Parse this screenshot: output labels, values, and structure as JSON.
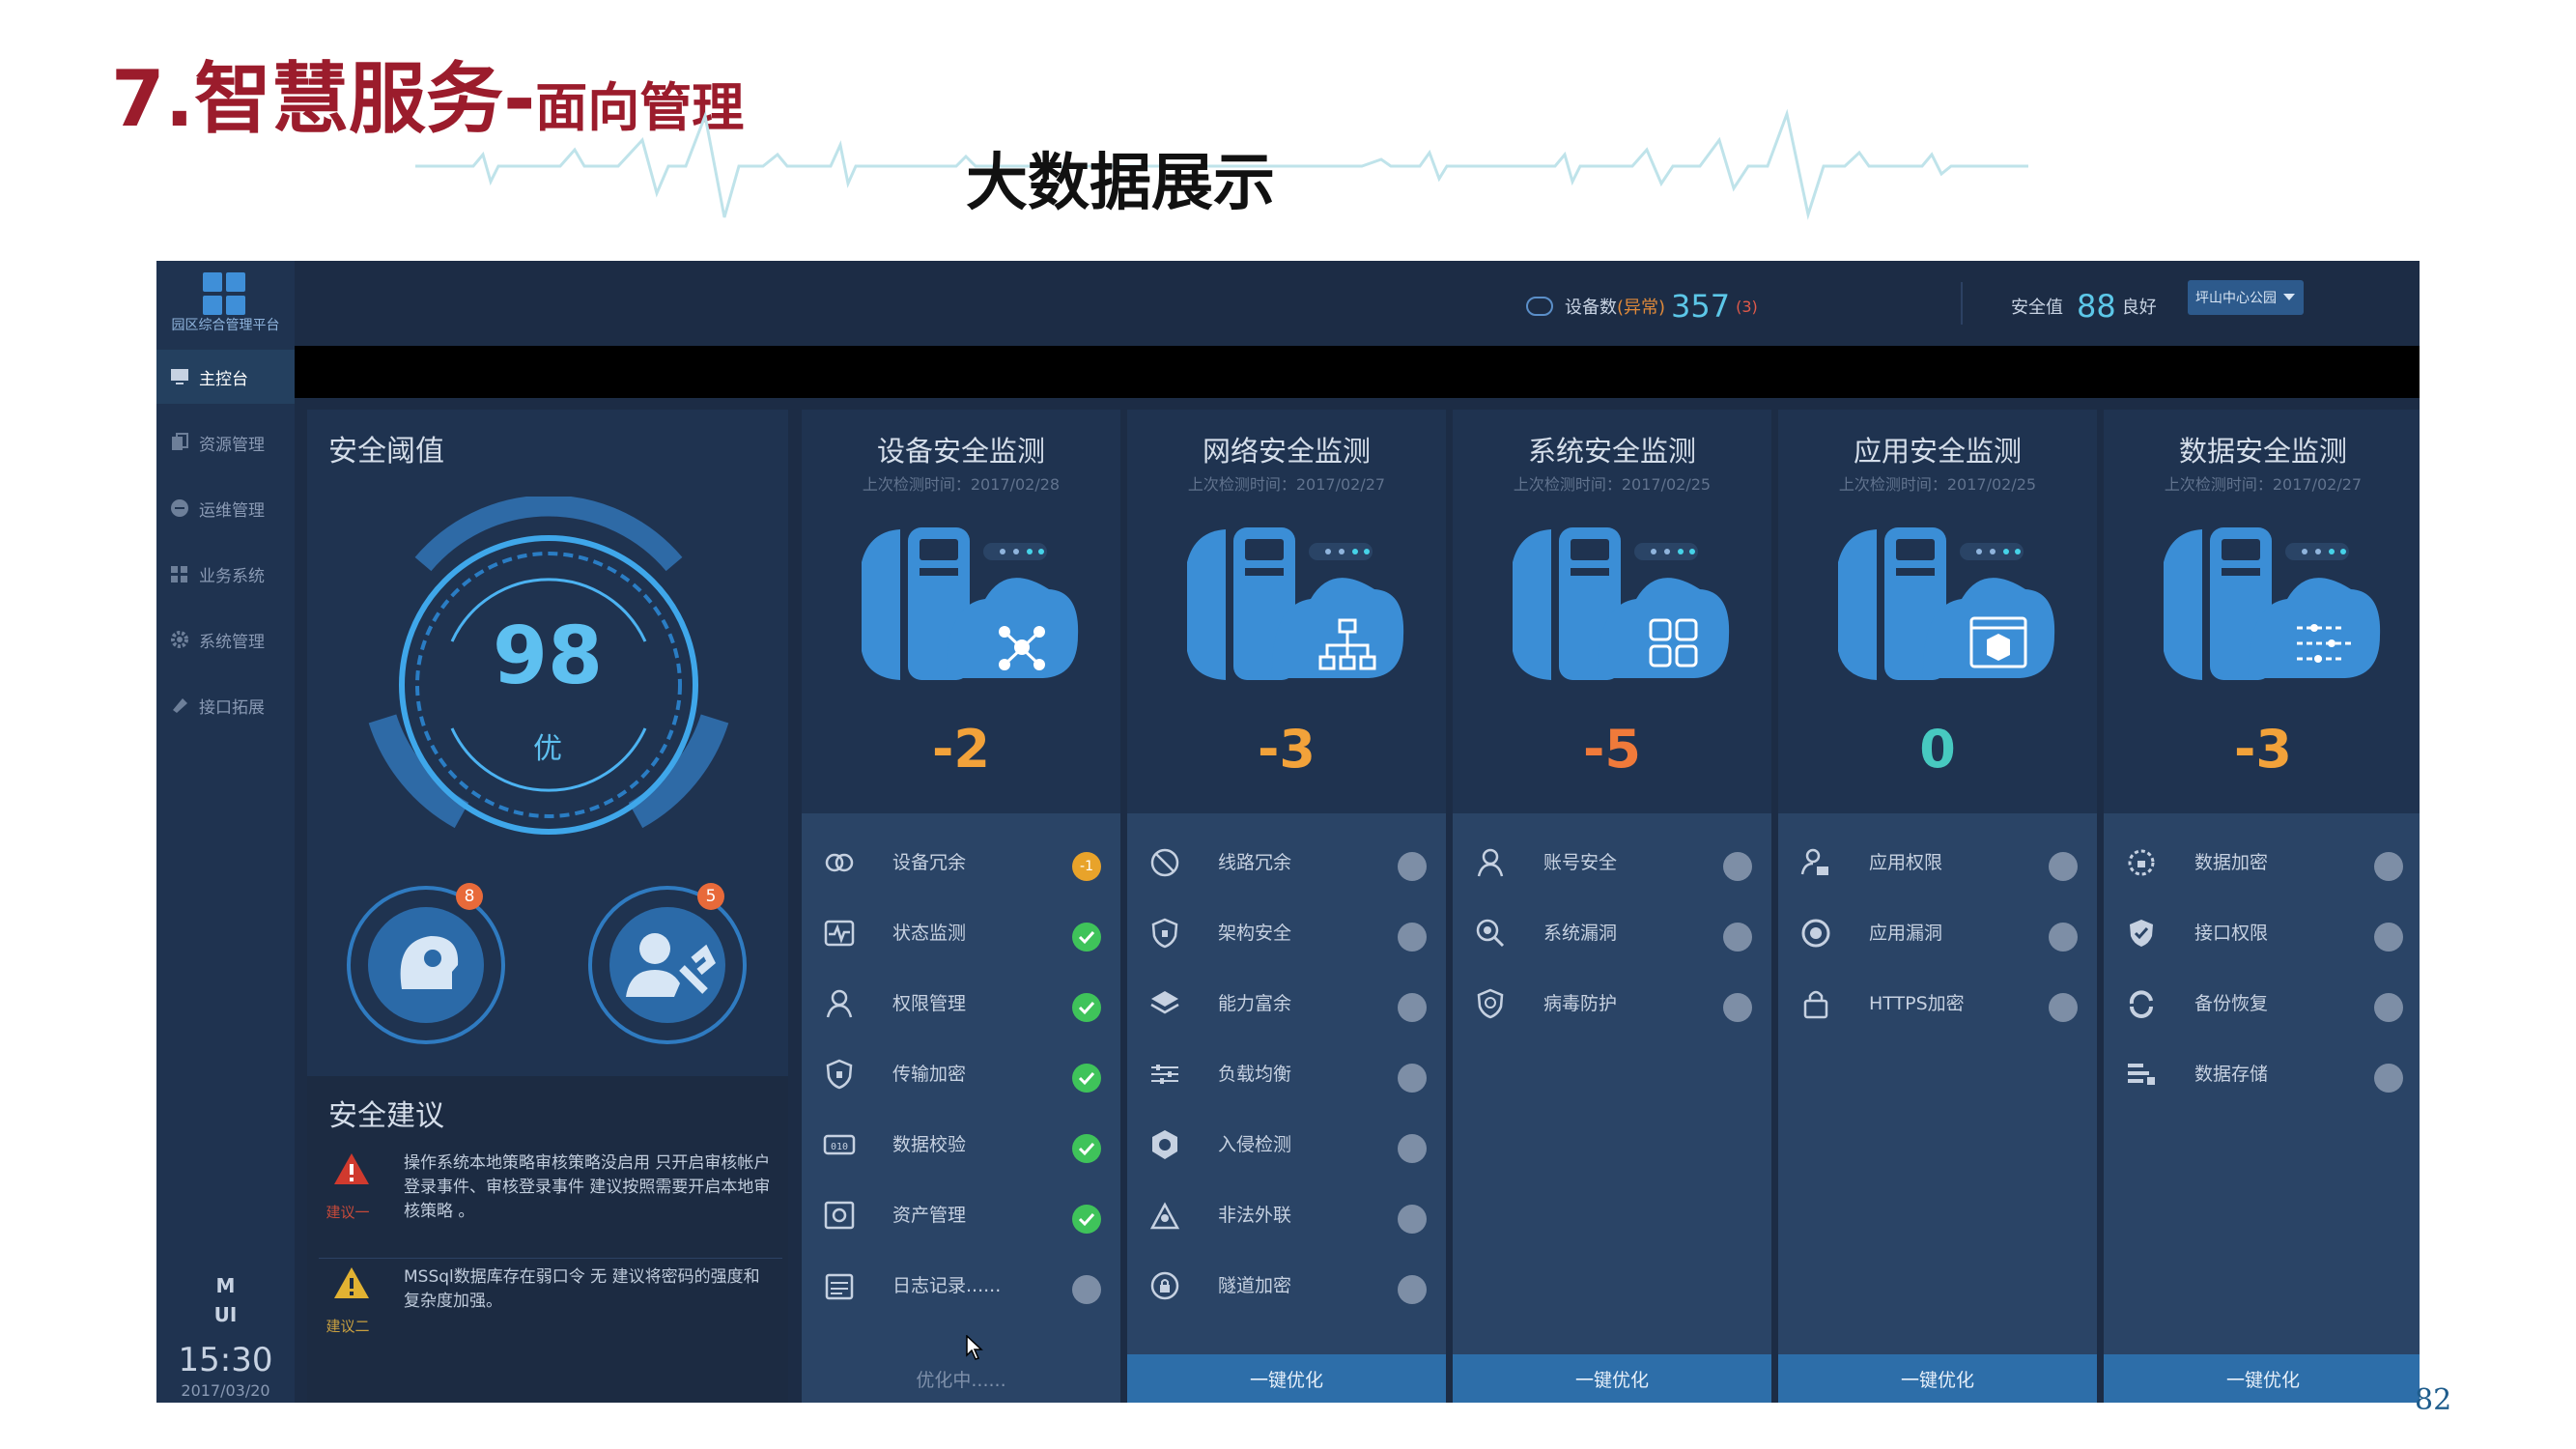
{
  "slide": {
    "title_main": "7.智慧服务",
    "title_sep": "-",
    "title_tail": "面向管理",
    "subtitle": "大数据展示",
    "page_number": "82"
  },
  "app": {
    "logo_text": "园区综合管理平台",
    "nav": [
      {
        "label": "主控台",
        "icon": "monitor-icon"
      },
      {
        "label": "资源管理",
        "icon": "copy-icon"
      },
      {
        "label": "运维管理",
        "icon": "minus-circle-icon"
      },
      {
        "label": "业务系统",
        "icon": "grid-icon"
      },
      {
        "label": "系统管理",
        "icon": "gear-icon"
      },
      {
        "label": "接口拓展",
        "icon": "pin-icon"
      }
    ],
    "mui_line1": "M",
    "mui_line2": "UI",
    "clock": "15:30",
    "date": "2017/03/20",
    "topbar": {
      "devices_label": "设备数",
      "devices_abnormal_label": "(异常)",
      "devices_count": "357",
      "devices_abnormal_count": "(3)",
      "safety_label": "安全值",
      "safety_value": "88",
      "safety_status": "良好",
      "location_select": "坪山中心公园"
    },
    "threshold": {
      "title": "安全阈值",
      "score": "98",
      "grade": "优",
      "badge_left": "8",
      "badge_right": "5"
    },
    "advice": {
      "title": "安全建议",
      "items": [
        {
          "tag": "建议一",
          "text": "操作系统本地策略审核策略没启用 只开启审核帐户登录事件、审核登录事件 建议按照需要开启本地审核策略 。"
        },
        {
          "tag": "建议二",
          "text": "MSSql数据库存在弱口令 无 建议将密码的强度和复杂度加强。"
        }
      ]
    },
    "columns": [
      {
        "title": "设备安全监测",
        "last_check": "上次检测时间：2017/02/28",
        "score": "-2",
        "score_color": "#f2a23a",
        "emblem": "nodes-icon",
        "button": "优化中......",
        "items": [
          {
            "label": "设备冗余",
            "icon": "link-icon",
            "status": "warn",
            "badge": "-1"
          },
          {
            "label": "状态监测",
            "icon": "pulse-icon",
            "status": "ok"
          },
          {
            "label": "权限管理",
            "icon": "user-icon",
            "status": "ok"
          },
          {
            "label": "传输加密",
            "icon": "shield-icon",
            "status": "ok"
          },
          {
            "label": "数据校验",
            "icon": "binary-icon",
            "status": "ok"
          },
          {
            "label": "资产管理",
            "icon": "safe-icon",
            "status": "ok"
          },
          {
            "label": "日志记录......",
            "icon": "calendar-icon",
            "status": "off"
          }
        ]
      },
      {
        "title": "网络安全监测",
        "last_check": "上次检测时间：2017/02/27",
        "score": "-3",
        "score_color": "#f2a23a",
        "emblem": "tree-icon",
        "button": "一键优化",
        "items": [
          {
            "label": "线路冗余",
            "icon": "ban-icon",
            "status": "off"
          },
          {
            "label": "架构安全",
            "icon": "shield-icon",
            "status": "off"
          },
          {
            "label": "能力富余",
            "icon": "layers-icon",
            "status": "off"
          },
          {
            "label": "负载均衡",
            "icon": "sliders-icon",
            "status": "off"
          },
          {
            "label": "入侵检测",
            "icon": "hex-shield-icon",
            "status": "off"
          },
          {
            "label": "非法外联",
            "icon": "radar-icon",
            "status": "off"
          },
          {
            "label": "隧道加密",
            "icon": "lock-circle-icon",
            "status": "off"
          }
        ]
      },
      {
        "title": "系统安全监测",
        "last_check": "上次检测时间：2017/02/25",
        "score": "-5",
        "score_color": "#f07a3a",
        "emblem": "apps-icon",
        "button": "一键优化",
        "items": [
          {
            "label": "账号安全",
            "icon": "user-icon",
            "status": "off"
          },
          {
            "label": "系统漏洞",
            "icon": "search-bug-icon",
            "status": "off"
          },
          {
            "label": "病毒防护",
            "icon": "virus-shield-icon",
            "status": "off"
          }
        ]
      },
      {
        "title": "应用安全监测",
        "last_check": "上次检测时间：2017/02/25",
        "score": "0",
        "score_color": "#47c9c0",
        "emblem": "box-window-icon",
        "button": "一键优化",
        "items": [
          {
            "label": "应用权限",
            "icon": "user-lock-icon",
            "status": "off"
          },
          {
            "label": "应用漏洞",
            "icon": "ring-icon",
            "status": "off"
          },
          {
            "label": "HTTPS加密",
            "icon": "lock-icon",
            "status": "off"
          }
        ]
      },
      {
        "title": "数据安全监测",
        "last_check": "上次检测时间：2017/02/27",
        "score": "-3",
        "score_color": "#f2a23a",
        "emblem": "flow-icon",
        "button": "一键优化",
        "items": [
          {
            "label": "数据加密",
            "icon": "gear-lock-icon",
            "status": "off"
          },
          {
            "label": "接口权限",
            "icon": "shield-check-icon",
            "status": "off"
          },
          {
            "label": "备份恢复",
            "icon": "refresh-icon",
            "status": "off"
          },
          {
            "label": "数据存储",
            "icon": "list-icon",
            "status": "off"
          }
        ]
      }
    ]
  }
}
